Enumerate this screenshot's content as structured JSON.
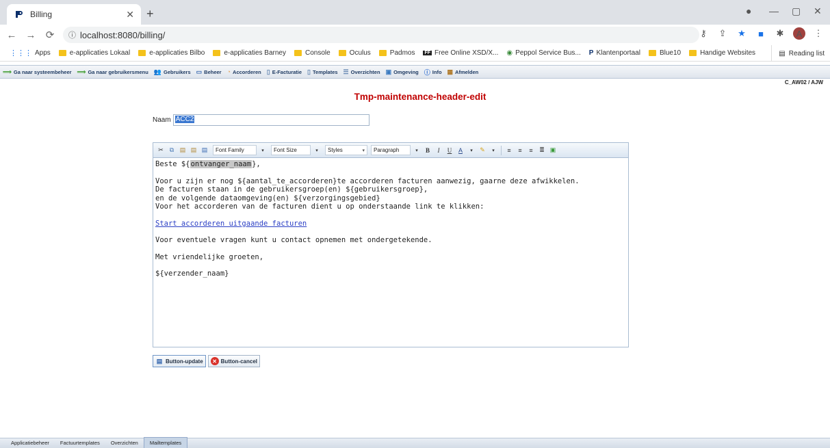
{
  "browser": {
    "tab_title": "Billing",
    "url": "localhost:8080/billing/",
    "avatar_letter": "A",
    "bookmarks": [
      {
        "label": "Apps",
        "icon": "apps-grid-icon"
      },
      {
        "label": "e-applicaties Lokaal",
        "icon": "folder-icon"
      },
      {
        "label": "e-applicaties Bilbo",
        "icon": "folder-icon"
      },
      {
        "label": "e-applicaties Barney",
        "icon": "folder-icon"
      },
      {
        "label": "Console",
        "icon": "folder-icon"
      },
      {
        "label": "Oculus",
        "icon": "folder-icon"
      },
      {
        "label": "Padmos",
        "icon": "folder-icon"
      },
      {
        "label": "Free Online XSD/X...",
        "icon": "ff-site-icon"
      },
      {
        "label": "Peppol Service Bus...",
        "icon": "peppol-icon"
      },
      {
        "label": "Klantenportaal",
        "icon": "brand-p-icon"
      },
      {
        "label": "Blue10",
        "icon": "folder-icon"
      },
      {
        "label": "Handige Websites",
        "icon": "folder-icon"
      }
    ],
    "reading_list": "Reading list"
  },
  "app_menu": [
    {
      "label": "Ga naar systeembeheer",
      "icon": "green-arrow-icon"
    },
    {
      "label": "Ga naar gebruikersmenu",
      "icon": "green-arrow-icon"
    },
    {
      "label": "Gebruikers",
      "icon": "users-icon"
    },
    {
      "label": "Beheer",
      "icon": "folder-icon"
    },
    {
      "label": "Accorderen",
      "icon": "approve-icon"
    },
    {
      "label": "E-Facturatie",
      "icon": "document-icon"
    },
    {
      "label": "Templates",
      "icon": "templates-icon"
    },
    {
      "label": "Overzichten",
      "icon": "list-icon"
    },
    {
      "label": "Omgeving",
      "icon": "environment-icon"
    },
    {
      "label": "Info",
      "icon": "info-icon"
    },
    {
      "label": "Afmelden",
      "icon": "logout-icon"
    }
  ],
  "user_id": "C_AW02 / AJW",
  "page_title": "Tmp-maintenance-header-edit",
  "form": {
    "naam_label": "Naam",
    "naam_value": "ACC2"
  },
  "editor": {
    "selects": [
      "Font Family",
      "Font Size",
      "Styles",
      "Paragraph"
    ],
    "line1_pre": "Beste ${",
    "line1_hl": "ontvanger_naam",
    "line1_post": "},",
    "para_lines": [
      "Voor u zijn er nog ${aantal_te_accorderen}te accorderen facturen aanwezig, gaarne deze afwikkelen.",
      "De facturen staan in de gebruikersgroep(en) ${gebruikersgroep},",
      "en de volgende dataomgeving(en) ${verzorgingsgebied}",
      "Voor het accorderen van de facturen dient u op onderstaande link te klikken:"
    ],
    "link": "Start accorderen uitgaande facturen",
    "contact": "Voor eventuele vragen kunt u contact opnemen met ondergetekende.",
    "greeting": "Met vriendelijke groeten,",
    "sender": "${verzender_naam}"
  },
  "buttons": {
    "update": "Button-update",
    "cancel": "Button-cancel"
  },
  "bottom_tabs": [
    "Applicatiebeheer",
    "Factuurtemplates",
    "Overzichten",
    "Mailtemplates"
  ],
  "active_bottom_tab": "Mailtemplates",
  "colors": {
    "title": "#c00000",
    "link": "#2a3ec4",
    "highlight": "#c7c7c7"
  }
}
